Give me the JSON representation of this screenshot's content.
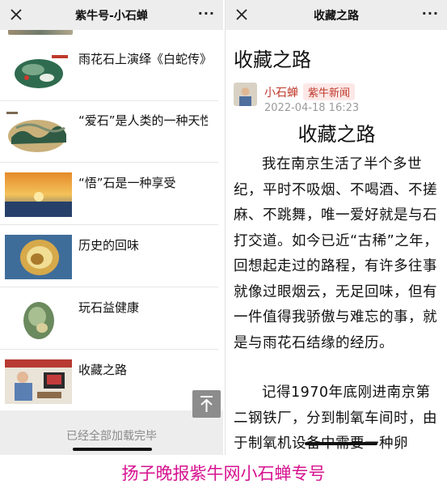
{
  "left_panel": {
    "nav_title": "紫牛号-小石蝉",
    "nav_close_icon": "close-icon",
    "nav_more_icon": "more-dots-icon",
    "nav_more_text": "···",
    "articles": [
      {
        "title": "雨花石上演绎《白蛇传》",
        "thumb": "green-jade-stone"
      },
      {
        "title": "“爱石”是人类的一种天性，上党自身的发展",
        "thumb": "landscape-stone"
      },
      {
        "title": "“悟”石是一种享受",
        "thumb": "sunset-landscape"
      },
      {
        "title": "历史的回味",
        "thumb": "agate-stone"
      },
      {
        "title": "玩石益健康",
        "thumb": "green-pebble"
      },
      {
        "title": "收藏之路",
        "thumb": "person-photo"
      }
    ],
    "load_complete": "已经全部加载完毕",
    "back_to_top_icon": "arrow-up-to-top-icon"
  },
  "right_panel": {
    "nav_title": "收藏之路",
    "nav_close_icon": "close-icon",
    "nav_more_icon": "more-dots-icon",
    "nav_more_text": "···",
    "article_title": "收藏之路",
    "author_name": "小石蝉",
    "publisher": "紫牛新闻",
    "publish_time": "2022-04-18 16:23",
    "subheading": "收藏之路",
    "paragraphs": [
      "我在南京生活了半个多世纪，平时不吸烟、不喝酒、不搓麻、不跳舞，唯一爱好就是与石打交道。如今已近“古稀”之年，回想起走过的路程，有许多往事就像过眼烟云，无足回味，但有一件值得我骄傲与难忘的事，就是与雨花石结缘的经历。",
      "记得1970年底刚进南京第二钢铁厂，分到制氧车间时，由于制氧机设备中需要一种卵"
    ]
  },
  "caption": "扬子晚报紫牛网小石蝉专号",
  "colors": {
    "accent_red": "#c0392b",
    "caption_magenta": "#d6138f",
    "nav_bg": "#ededed"
  }
}
